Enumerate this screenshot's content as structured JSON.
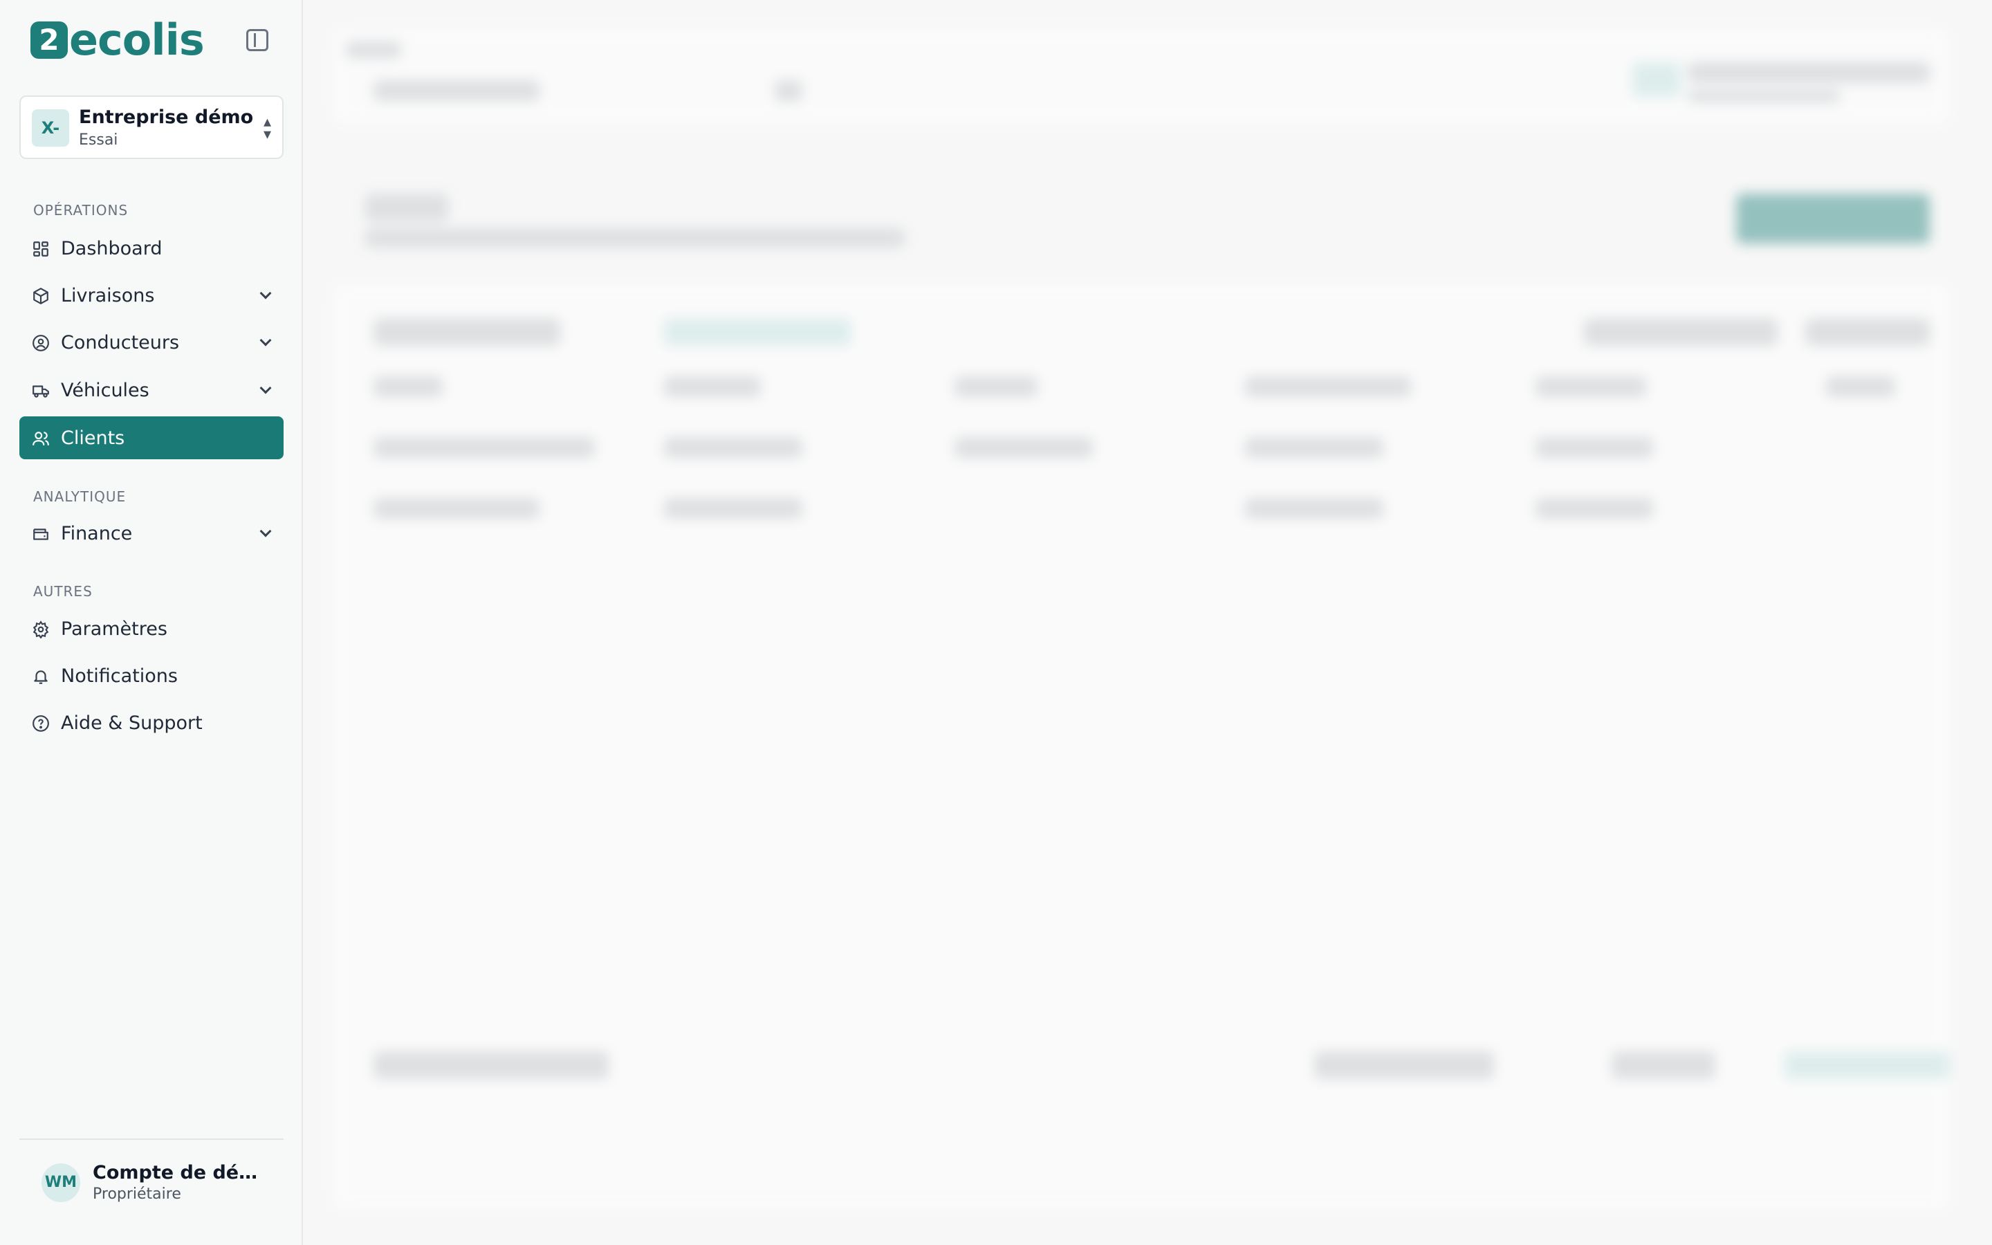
{
  "app": {
    "logo_mark": "2",
    "logo_text": "ecolis"
  },
  "company": {
    "badge": "X-",
    "name": "Entreprise démo",
    "plan": "Essai"
  },
  "sections": {
    "operations": "OPÉRATIONS",
    "analytics": "ANALYTIQUE",
    "others": "AUTRES"
  },
  "nav": {
    "dashboard": "Dashboard",
    "livraisons": "Livraisons",
    "conducteurs": "Conducteurs",
    "vehicules": "Véhicules",
    "clients": "Clients",
    "finance": "Finance",
    "parametres": "Paramètres",
    "notifications": "Notifications",
    "aide": "Aide & Support"
  },
  "user": {
    "initials": "WM",
    "name": "Compte de démo",
    "role": "Propriétaire"
  },
  "colors": {
    "brand": "#1e7f7a",
    "active_bg": "#1a7b76",
    "sidebar_bg": "#f7f8f8"
  }
}
